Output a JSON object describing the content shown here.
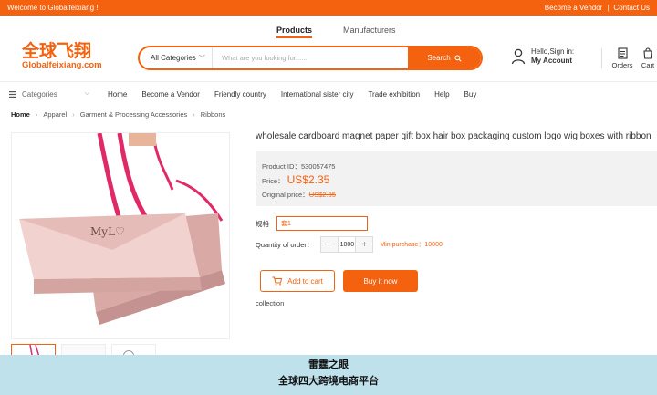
{
  "topbar": {
    "welcome": "Welcome to Globalfeixiang !",
    "vendor": "Become a Vendor",
    "separator": "|",
    "contact": "Contact Us"
  },
  "header_tabs": {
    "products": "Products",
    "manufacturers": "Manufacturers"
  },
  "logo": {
    "cn": "全球飞翔",
    "en": "Globalfeixiang.com"
  },
  "search": {
    "category": "All Categories",
    "placeholder": "What are you looking for......",
    "button": "Search"
  },
  "account": {
    "line1": "Hello,Sign in:",
    "line2": "My Account"
  },
  "orders_label": "Orders",
  "cart_label": "Cart",
  "nav": {
    "categories": "Categories",
    "items": [
      "Home",
      "Become a Vendor",
      "Friendly country",
      "International sister city",
      "Trade exhibition",
      "Help",
      "Buy"
    ]
  },
  "breadcrumb": [
    "Home",
    "Apparel",
    "Garment & Processing Accessories",
    "Ribbons"
  ],
  "product": {
    "title": "wholesale cardboard magnet paper gift box hair box packaging custom logo wig boxes with ribbon",
    "id_label": "Product ID：",
    "id": "530057475",
    "price_label": "Price：",
    "price": "US$2.35",
    "orig_label": "Original price：",
    "orig_price": "US$2.35",
    "spec_label": "规格",
    "spec_value": "套1",
    "qty_label": "Quantity of order：",
    "qty": "1000",
    "min_purchase": "Min purchase：10000",
    "add_cart": "Add to cart",
    "buy_now": "Buy it now",
    "collection": "collection",
    "bag_brand": "MyL♡"
  },
  "overlay": {
    "line1": "雷霆之眼",
    "line2": "全球四大跨境电商平台"
  },
  "colors": {
    "accent": "#f5620f",
    "overlay": "#bfe1ec"
  }
}
